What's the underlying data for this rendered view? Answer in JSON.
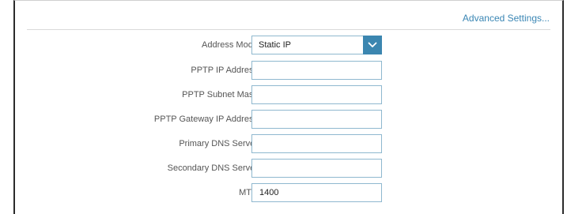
{
  "header": {
    "advanced_link": "Advanced Settings..."
  },
  "form": {
    "address_mode": {
      "label": "Address Mode:",
      "value": "Static IP"
    },
    "pptp_ip": {
      "label": "PPTP IP Address:",
      "value": ""
    },
    "pptp_subnet": {
      "label": "PPTP Subnet Mask:",
      "value": ""
    },
    "pptp_gateway": {
      "label": "PPTP Gateway IP Address:",
      "value": ""
    },
    "primary_dns": {
      "label": "Primary DNS Server:",
      "value": ""
    },
    "secondary_dns": {
      "label": "Secondary DNS Server:",
      "value": ""
    },
    "mtu": {
      "label": "MTU:",
      "value": "1400"
    }
  },
  "colors": {
    "accent": "#3b86b0",
    "link": "#3a86b4",
    "field_border": "#8fb8cf",
    "label_text": "#555555"
  },
  "icons": {
    "dropdown": "chevron-down-icon"
  }
}
